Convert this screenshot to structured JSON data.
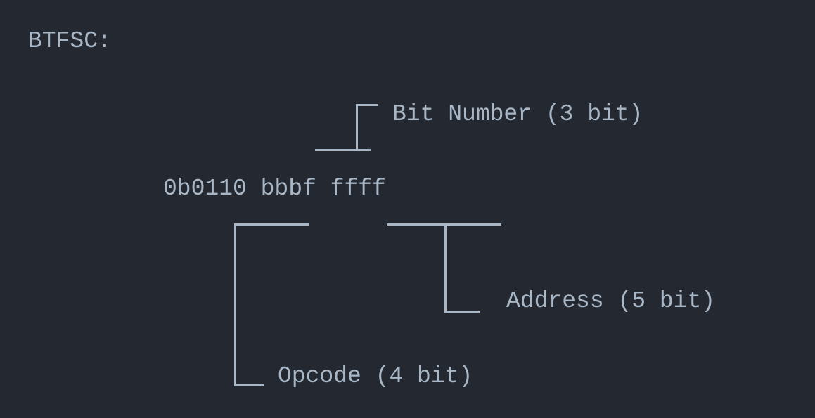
{
  "title": "BTFSC:",
  "instruction": "0b0110 bbbf ffff",
  "annotations": {
    "bit_number": "Bit Number (3 bit)",
    "address": "Address (5 bit)",
    "opcode": "Opcode (4 bit)"
  }
}
